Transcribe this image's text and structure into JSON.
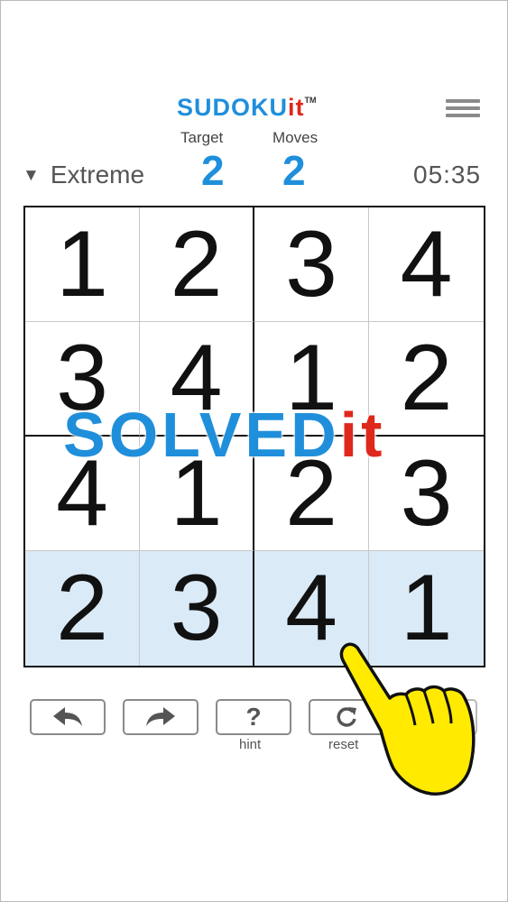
{
  "header": {
    "brand_main": "SUDOKU",
    "brand_accent": "it",
    "brand_tm": "TM",
    "menu_icon": "hamburger-menu-icon"
  },
  "stats": {
    "target_label": "Target",
    "target_value": "2",
    "moves_label": "Moves",
    "moves_value": "2"
  },
  "difficulty": {
    "arrow": "▼",
    "label": "Extreme"
  },
  "timer": "05:35",
  "board": {
    "cells": [
      [
        "1",
        "2",
        "3",
        "4"
      ],
      [
        "3",
        "4",
        "1",
        "2"
      ],
      [
        "4",
        "1",
        "2",
        "3"
      ],
      [
        "2",
        "3",
        "4",
        "1"
      ]
    ],
    "highlighted_row": 3
  },
  "overlay": {
    "solved_main": "SOLVED",
    "solved_accent": "it"
  },
  "controls": {
    "undo_icon": "undo-arrow-icon",
    "redo_icon": "redo-arrow-icon",
    "hint_icon": "question-mark-icon",
    "hint_symbol": "?",
    "hint_label": "hint",
    "reset_icon": "reset-arrow-icon",
    "reset_label": "reset"
  },
  "colors": {
    "brand_blue": "#1f8fdb",
    "brand_red": "#e0271c",
    "highlight_row": "#daeaf7",
    "hand_yellow": "#ffea00"
  }
}
